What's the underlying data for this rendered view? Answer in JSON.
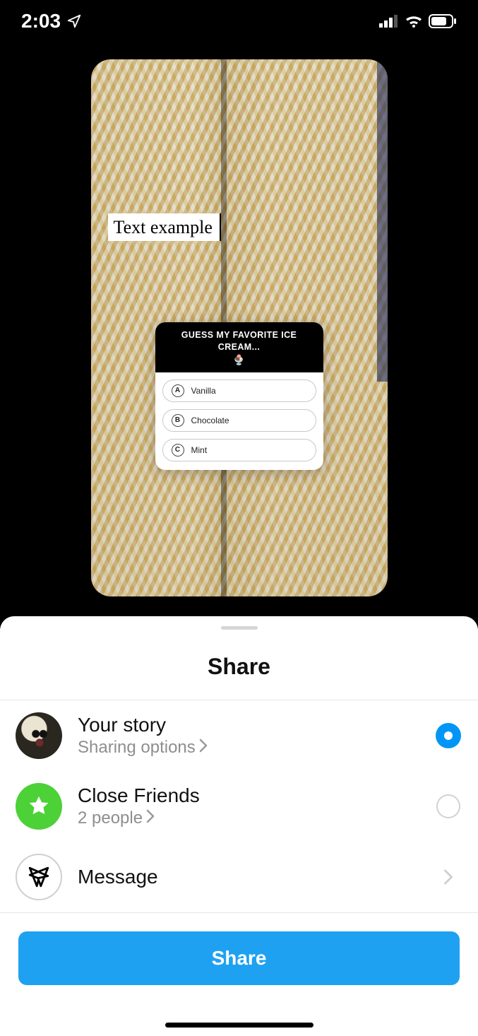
{
  "status": {
    "time": "2:03"
  },
  "story": {
    "text_overlay": "Text example",
    "quiz": {
      "title": "GUESS MY FAVORITE ICE CREAM...",
      "emoji": "🍨",
      "options": [
        {
          "letter": "A",
          "label": "Vanilla"
        },
        {
          "letter": "B",
          "label": "Chocolate"
        },
        {
          "letter": "C",
          "label": "Mint"
        }
      ]
    }
  },
  "sheet": {
    "title": "Share",
    "rows": {
      "your_story": {
        "title": "Your story",
        "subtitle": "Sharing options"
      },
      "close_friends": {
        "title": "Close Friends",
        "subtitle": "2 people"
      },
      "message": {
        "title": "Message"
      }
    },
    "share_button": "Share"
  }
}
